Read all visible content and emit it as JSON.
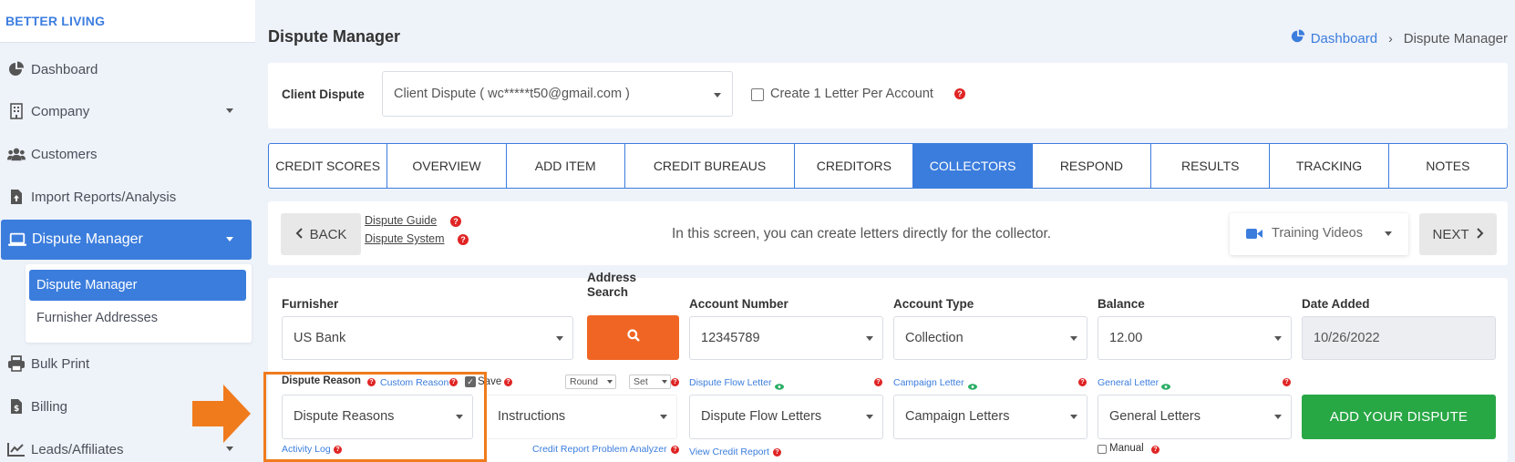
{
  "brand": "BETTER LIVING",
  "sidebar": {
    "items": [
      {
        "label": "Dashboard",
        "icon": "pie-chart-icon"
      },
      {
        "label": "Company",
        "icon": "building-icon"
      },
      {
        "label": "Customers",
        "icon": "users-icon"
      },
      {
        "label": "Import Reports/Analysis",
        "icon": "file-upload-icon"
      },
      {
        "label": "Dispute Manager",
        "icon": "laptop-icon"
      },
      {
        "label": "Bulk Print",
        "icon": "print-icon"
      },
      {
        "label": "Billing",
        "icon": "invoice-icon"
      },
      {
        "label": "Leads/Affiliates",
        "icon": "chart-line-icon"
      }
    ],
    "submenu": [
      "Dispute Manager",
      "Furnisher Addresses"
    ]
  },
  "header": {
    "title": "Dispute Manager",
    "breadcrumb": {
      "home": "Dashboard",
      "current": "Dispute Manager"
    }
  },
  "client": {
    "label": "Client Dispute",
    "value": "Client Dispute ( wc*****t50@gmail.com )",
    "checkbox_label": "Create 1 Letter Per Account"
  },
  "tabs": [
    "CREDIT SCORES",
    "OVERVIEW",
    "ADD ITEM",
    "CREDIT BUREAUS",
    "CREDITORS",
    "COLLECTORS",
    "RESPOND",
    "RESULTS",
    "TRACKING",
    "NOTES"
  ],
  "active_tab": "COLLECTORS",
  "navbar": {
    "back": "BACK",
    "guide": "Dispute Guide",
    "system": "Dispute System",
    "info": "In this screen, you can create letters directly for the collector.",
    "training": "Training Videos",
    "next": "NEXT"
  },
  "form": {
    "furnisher": {
      "label": "Furnisher",
      "value": "US Bank"
    },
    "address_search": {
      "label1": "Address",
      "label2": "Search"
    },
    "account_number": {
      "label": "Account Number",
      "value": "12345789"
    },
    "account_type": {
      "label": "Account Type",
      "value": "Collection"
    },
    "balance": {
      "label": "Balance",
      "value": "12.00"
    },
    "date_added": {
      "label": "Date Added",
      "value": "10/26/2022"
    },
    "dispute_reason": {
      "label": "Dispute Reason",
      "custom": "Custom Reason",
      "save": "Save",
      "value": "Dispute Reasons",
      "activity_log": "Activity Log"
    },
    "instructions": {
      "round": "Round",
      "set": "Set",
      "value": "Instructions",
      "analyzer": "Credit Report Problem Analyzer"
    },
    "dispute_flow": {
      "label": "Dispute Flow Letter",
      "value": "Dispute Flow Letters",
      "view": "View Credit Report"
    },
    "campaign": {
      "label": "Campaign Letter",
      "value": "Campaign Letters"
    },
    "general": {
      "label": "General Letter",
      "value": "General Letters",
      "manual": "Manual"
    },
    "add_button": "ADD YOUR DISPUTE"
  },
  "colors": {
    "primary": "#3b7ddd",
    "accent": "#f06524",
    "success": "#28a745",
    "help": "#e02424"
  }
}
